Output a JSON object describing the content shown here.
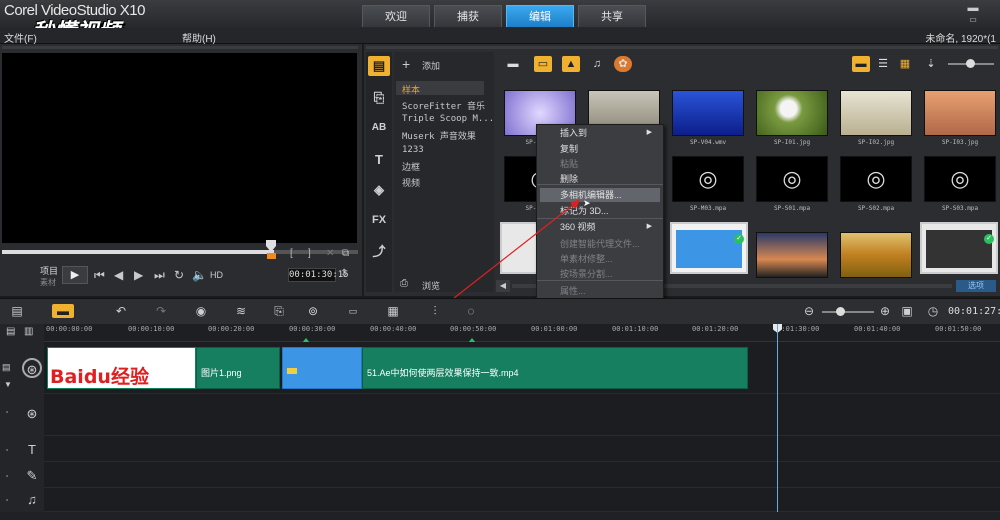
{
  "app": {
    "brand": "Corel VideoStudio X10",
    "watermark": "秒懂视频"
  },
  "tabs": [
    {
      "label": "欢迎"
    },
    {
      "label": "捕获"
    },
    {
      "label": "编辑"
    },
    {
      "label": "共享"
    }
  ],
  "menu": {
    "file": "文件(F)",
    "help": "帮助(H)",
    "project_info": "未命名, 1920*(1"
  },
  "preview": {
    "project_label": "项目",
    "clip_label": "素材",
    "hd_label": "HD",
    "timecode": "00:01:30:15"
  },
  "library": {
    "add_label": "添加",
    "browse_label": "浏览",
    "items": [
      "样本",
      "ScoreFitter 音乐",
      "Triple Scoop M...",
      "Muserk 声音效果",
      "1233",
      "边框",
      "视频"
    ],
    "thumbnails": [
      {
        "caption": "SP-V0..."
      },
      {
        "caption": ""
      },
      {
        "caption": "SP-V04.wmv"
      },
      {
        "caption": "SP-I01.jpg"
      },
      {
        "caption": "SP-I02.jpg"
      },
      {
        "caption": "SP-I03.jpg"
      },
      {
        "caption": "SP-M0..."
      },
      {
        "caption": ""
      },
      {
        "caption": "SP-M03.mpa"
      },
      {
        "caption": "SP-S01.mpa"
      },
      {
        "caption": "SP-S02.mpa"
      },
      {
        "caption": "SP-S03.mpa"
      },
      {
        "caption": ""
      },
      {
        "caption": ""
      },
      {
        "caption": ""
      },
      {
        "caption": ""
      },
      {
        "caption": ""
      },
      {
        "caption": ""
      }
    ],
    "options_label": "选项"
  },
  "context_menu": [
    {
      "label": "插入到",
      "disabled": false,
      "submenu": true
    },
    {
      "label": "复制",
      "disabled": false,
      "submenu": false
    },
    {
      "label": "粘贴",
      "disabled": true,
      "submenu": false
    },
    {
      "label": "删除",
      "disabled": false,
      "submenu": false
    },
    {
      "label": "多相机编辑器...",
      "disabled": false,
      "submenu": false,
      "highlighted": true
    },
    {
      "label": "标记为 3D...",
      "disabled": false,
      "submenu": false
    },
    {
      "label": "360 视频",
      "disabled": false,
      "submenu": true
    },
    {
      "label": "创建智能代理文件...",
      "disabled": true,
      "submenu": false
    },
    {
      "label": "单素材修整...",
      "disabled": true,
      "submenu": false
    },
    {
      "label": "按场景分割...",
      "disabled": true,
      "submenu": false
    },
    {
      "label": "属性...",
      "disabled": true,
      "submenu": false
    }
  ],
  "timeline": {
    "timecode": "00:01:27:02",
    "ruler": [
      "00:00:00:00",
      "00:00:10:00",
      "00:00:20:00",
      "00:00:30:00",
      "00:00:40:00",
      "00:00:50:00",
      "00:01:00:00",
      "00:01:10:00",
      "00:01:20:00",
      "00:01:30:00",
      "00:01:40:00",
      "00:01:50:00"
    ],
    "clips": [
      {
        "label": "Baidu经验"
      },
      {
        "label": "图片1.png"
      },
      {
        "label": ""
      },
      {
        "label": "51.Ae中如何使两层效果保持一致.mp4"
      }
    ]
  }
}
